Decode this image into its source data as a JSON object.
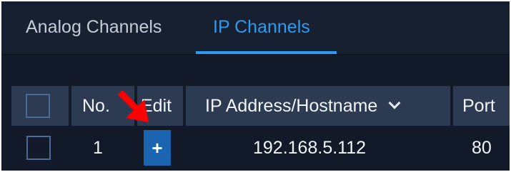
{
  "tabs": [
    {
      "label": "Analog Channels",
      "active": false
    },
    {
      "label": "IP Channels",
      "active": true
    }
  ],
  "table": {
    "headers": {
      "select_all": "",
      "no": "No.",
      "edit": "Edit",
      "ip_address": "IP Address/Hostname",
      "port": "Port"
    },
    "rows": [
      {
        "no": "1",
        "edit_icon": "+",
        "ip_address": "192.168.5.112",
        "port": "80"
      }
    ]
  },
  "colors": {
    "accent": "#2e9bf0",
    "header_bg": "#2c3b52",
    "background": "#121a2a",
    "annotation_arrow": "#ff0000",
    "add_button": "#1a64b0"
  },
  "icons": {
    "ip_sort": "chevron-down-icon",
    "edit": "plus-icon",
    "annotation": "red-arrow-icon"
  }
}
